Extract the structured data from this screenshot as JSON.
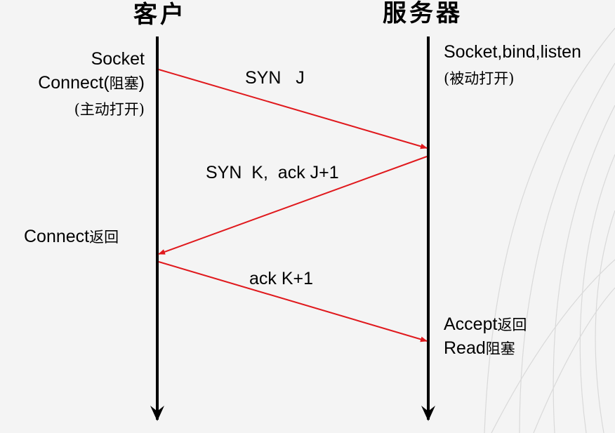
{
  "titles": {
    "client": "客户",
    "server": "服务器"
  },
  "client_notes": {
    "socket": "Socket",
    "connect_prefix": "Connect(",
    "connect_block": "阻塞",
    "connect_suffix": ")",
    "active_open": "(主动打开)",
    "connect_return_prefix": "Connect",
    "connect_return_cn": "返回"
  },
  "server_notes": {
    "socket_bind_listen": "Socket,bind,listen",
    "passive_open": "(被动打开)",
    "accept_prefix": "Accept",
    "accept_cn": "返回",
    "read_prefix": "Read",
    "read_cn": "阻塞"
  },
  "messages": {
    "syn": "SYN   J",
    "syn_ack": "SYN  K,  ack J+1",
    "ack": "ack K+1"
  },
  "colors": {
    "lifeline": "#000000",
    "message_arrow": "#e0191d"
  }
}
